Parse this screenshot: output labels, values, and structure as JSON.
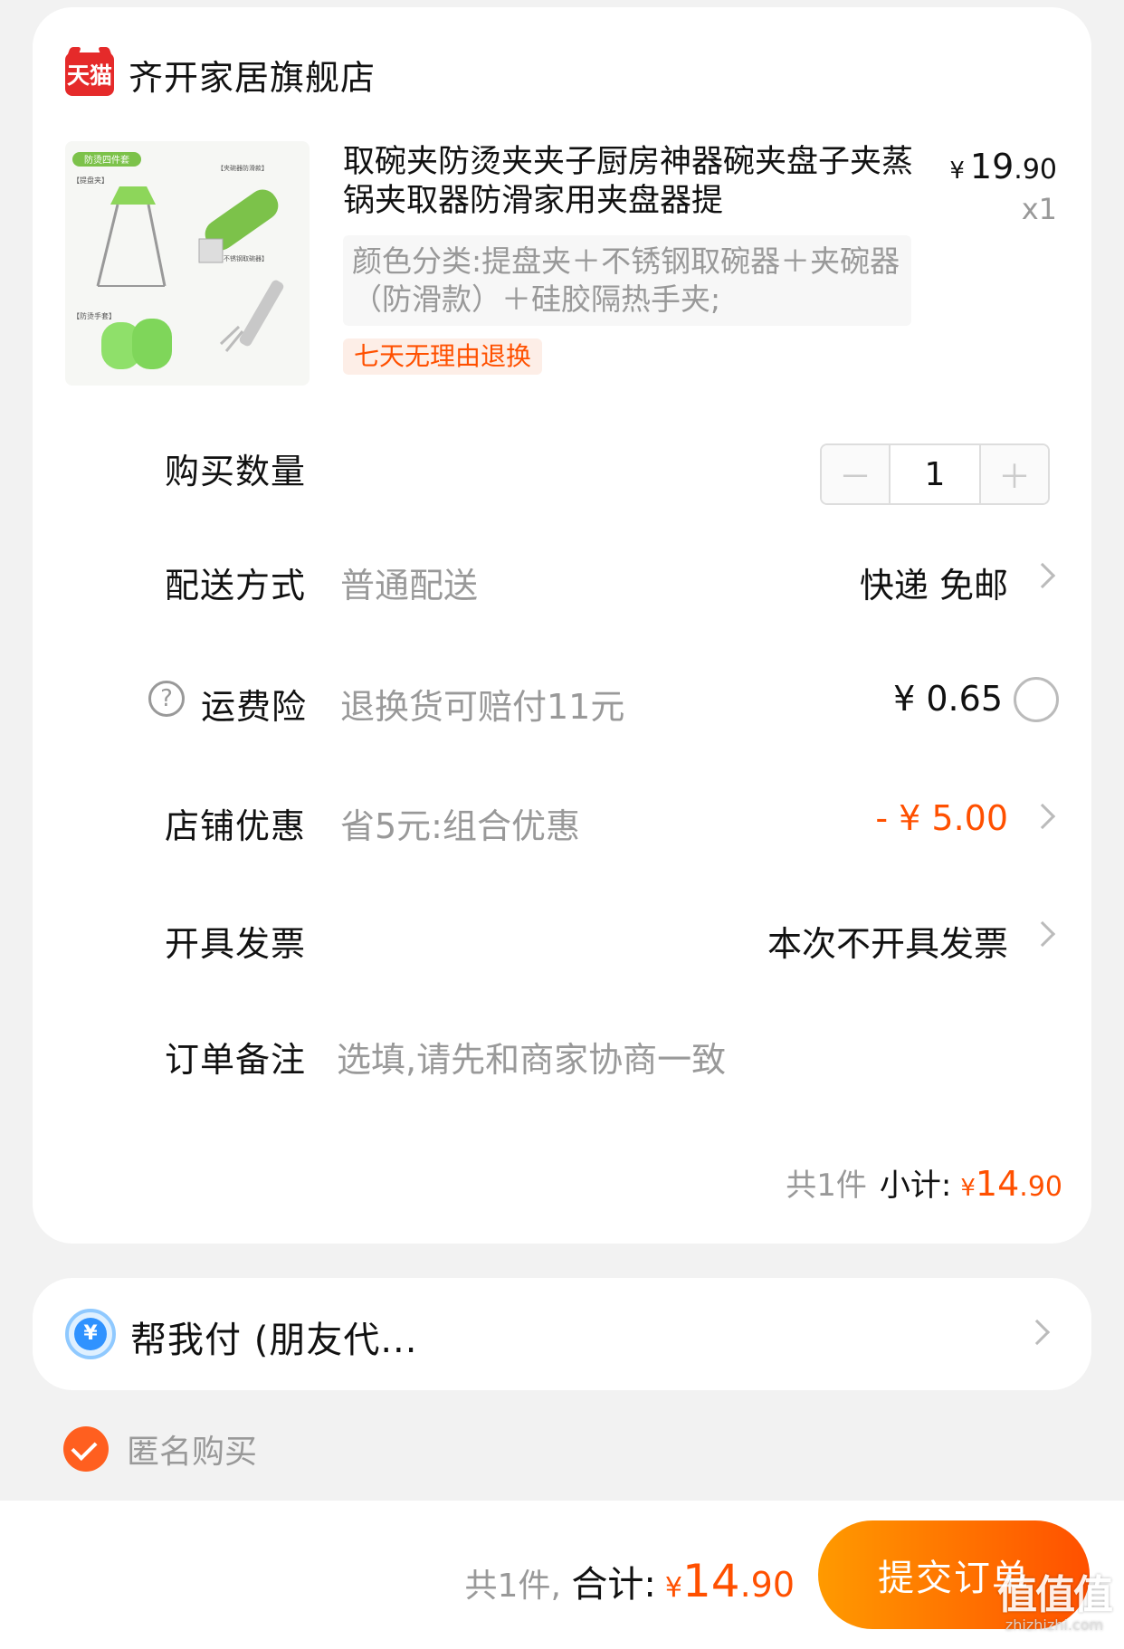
{
  "store": {
    "logo_text": "天猫",
    "name": "齐开家居旗舰店"
  },
  "product": {
    "title": "取碗夹防烫夹夹子厨房神器碗夹盘子夹蒸锅夹取器防滑家用夹盘器提",
    "price_symbol": "¥",
    "price_int": "19",
    "price_dec": ".90",
    "quantity_label": "x1",
    "sku": "颜色分类:提盘夹＋不锈钢取碗器＋夹碗器（防滑款）＋硅胶隔热手夹;",
    "return_tag": "七天无理由退换",
    "image_labels": [
      "防烫四件套",
      "【提盘夹】",
      "【夹碗器防滑款】",
      "【不锈钢取碗器】",
      "【防烫手套】"
    ]
  },
  "quantity": {
    "label": "购买数量",
    "minus": "－",
    "value": "1",
    "plus": "＋"
  },
  "delivery": {
    "label": "配送方式",
    "desc": "普通配送",
    "value": "快递 免邮"
  },
  "insurance": {
    "help_icon": "?",
    "label": "运费险",
    "desc": "退换货可赔付11元",
    "value": "¥ 0.65"
  },
  "discount": {
    "label": "店铺优惠",
    "desc": "省5元:组合优惠",
    "value": "- ¥ 5.00"
  },
  "invoice": {
    "label": "开具发票",
    "value": "本次不开具发票"
  },
  "note": {
    "label": "订单备注",
    "placeholder": "选填,请先和商家协商一致"
  },
  "subtotal": {
    "count": "共1件",
    "label": "小计:",
    "yen": "¥",
    "int": "14",
    "dec": ".90"
  },
  "friend_pay": {
    "icon": "¥",
    "label": "帮我付 (朋友代..."
  },
  "anonymous": {
    "label": "匿名购买",
    "checked": true
  },
  "footer": {
    "count": "共1件,",
    "label": "合计:",
    "yen": "¥",
    "int": "14",
    "dec": ".90",
    "submit": "提交订单"
  },
  "watermark": {
    "big": "值值值",
    "small": "zhizhizhi.com"
  },
  "colors": {
    "accent": "#ff5000",
    "button_gradient": [
      "#ff9a00",
      "#ff5000"
    ],
    "tmall_red": "#e52a2a"
  }
}
